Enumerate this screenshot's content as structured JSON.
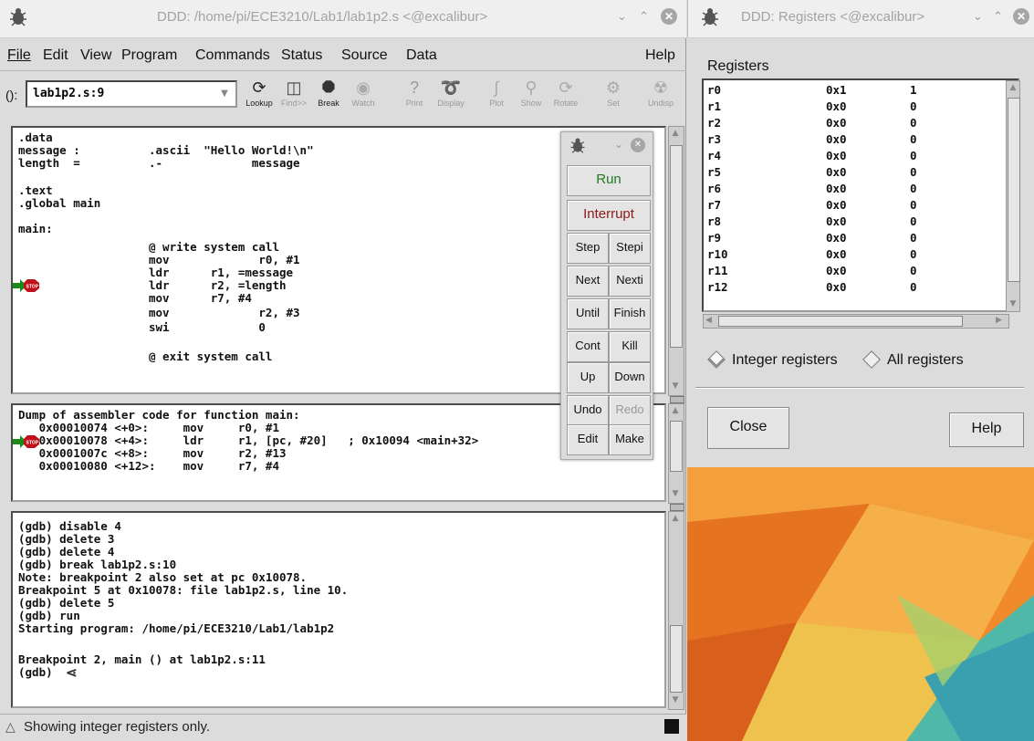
{
  "main_window": {
    "title": "DDD: /home/pi/ECE3210/Lab1/lab1p2.s <@excalibur>",
    "menu": [
      "File",
      "Edit",
      "View",
      "Program",
      "Commands",
      "Status",
      "Source",
      "Data",
      "Help"
    ],
    "arg_label": "():",
    "arg_value": "lab1p2.s:9",
    "toolbar": [
      "Lookup",
      "Find>>",
      "Break",
      "Watch",
      "Print",
      "Display",
      "Plot",
      "Show",
      "Rotate",
      "Set",
      "Undisp"
    ]
  },
  "source": {
    "lines": [
      ".data",
      "message :          .ascii  \"Hello World!\\n\"",
      "length  =          .-             message",
      "",
      ".text",
      ".global main",
      "",
      "main:",
      "                   @ write system call",
      "                   mov             r0, #1",
      "                   ldr      r1, =message",
      "                   ldr      r2, =length",
      "                   mov      r7, #4",
      "                   mov             r2, #3",
      "                   swi             0",
      "",
      "                   @ exit system call"
    ]
  },
  "assembler": {
    "lines": [
      "Dump of assembler code for function main:",
      "   0x00010074 <+0>:     mov     r0, #1",
      "   0x00010078 <+4>:     ldr     r1, [pc, #20]   ; 0x10094 <main+32>",
      "   0x0001007c <+8>:     mov     r2, #13",
      "   0x00010080 <+12>:    mov     r7, #4"
    ]
  },
  "console": {
    "lines": [
      "(gdb) disable 4",
      "(gdb) delete 3",
      "(gdb) delete 4",
      "(gdb) break lab1p2.s:10",
      "Note: breakpoint 2 also set at pc 0x10078.",
      "Breakpoint 5 at 0x10078: file lab1p2.s, line 10.",
      "(gdb) delete 5",
      "(gdb) run",
      "Starting program: /home/pi/ECE3210/Lab1/lab1p2",
      "",
      "Breakpoint 2, main () at lab1p2.s:11",
      "(gdb) "
    ]
  },
  "status_text": "Showing integer registers only.",
  "command_tool": {
    "run": "Run",
    "interrupt": "Interrupt",
    "buttons": [
      [
        "Step",
        "Stepi"
      ],
      [
        "Next",
        "Nexti"
      ],
      [
        "Until",
        "Finish"
      ],
      [
        "Cont",
        "Kill"
      ],
      [
        "Up",
        "Down"
      ],
      [
        "Undo",
        "Redo"
      ],
      [
        "Edit",
        "Make"
      ]
    ]
  },
  "registers_window": {
    "title": "DDD: Registers <@excalibur>",
    "heading": "Registers",
    "rows": [
      {
        "name": "r0",
        "hex": "0x1",
        "dec": "1"
      },
      {
        "name": "r1",
        "hex": "0x0",
        "dec": "0"
      },
      {
        "name": "r2",
        "hex": "0x0",
        "dec": "0"
      },
      {
        "name": "r3",
        "hex": "0x0",
        "dec": "0"
      },
      {
        "name": "r4",
        "hex": "0x0",
        "dec": "0"
      },
      {
        "name": "r5",
        "hex": "0x0",
        "dec": "0"
      },
      {
        "name": "r6",
        "hex": "0x0",
        "dec": "0"
      },
      {
        "name": "r7",
        "hex": "0x0",
        "dec": "0"
      },
      {
        "name": "r8",
        "hex": "0x0",
        "dec": "0"
      },
      {
        "name": "r9",
        "hex": "0x0",
        "dec": "0"
      },
      {
        "name": "r10",
        "hex": "0x0",
        "dec": "0"
      },
      {
        "name": "r11",
        "hex": "0x0",
        "dec": "0"
      },
      {
        "name": "r12",
        "hex": "0x0",
        "dec": "0"
      }
    ],
    "integer_option": "Integer registers",
    "all_option": "All registers",
    "close_label": "Close",
    "help_label": "Help"
  },
  "colors": {
    "run": "#1f7a1f",
    "interrupt": "#8b1a1a",
    "stop_sign": "#c0101a",
    "arrow": "#1a8a1a"
  }
}
